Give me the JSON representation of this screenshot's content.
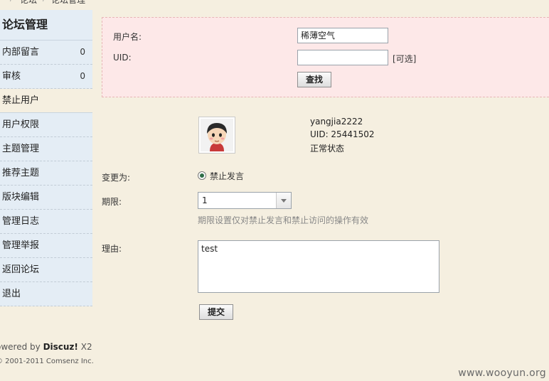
{
  "breadcrumb": {
    "items": [
      "论坛",
      "论坛管理"
    ],
    "separator": "/"
  },
  "sidebar": {
    "title": "论坛管理",
    "items": [
      {
        "label": "内部留言",
        "count": "0"
      },
      {
        "label": "审核",
        "count": "0"
      },
      {
        "label": "禁止用户",
        "count": ""
      },
      {
        "label": "用户权限",
        "count": ""
      },
      {
        "label": "主题管理",
        "count": ""
      },
      {
        "label": "推荐主题",
        "count": ""
      },
      {
        "label": "版块编辑",
        "count": ""
      },
      {
        "label": "管理日志",
        "count": ""
      },
      {
        "label": "管理举报",
        "count": ""
      },
      {
        "label": "返回论坛",
        "count": ""
      },
      {
        "label": "退出",
        "count": ""
      }
    ],
    "active_index": 2
  },
  "search": {
    "username_label": "用户名:",
    "username_value": "稀薄空气",
    "uid_label": "UID:",
    "uid_value": "",
    "uid_optional": "[可选]",
    "search_button": "查找"
  },
  "user": {
    "avatar_icon": "avatar-cartoon-icon",
    "name": "yangjia2222",
    "uid": "UID: 25441502",
    "status": "正常状态"
  },
  "form": {
    "change_to_label": "变更为:",
    "change_to_option": "禁止发言",
    "period_label": "期限:",
    "period_value": "1",
    "period_hint": "期限设置仅对禁止发言和禁止访问的操作有效",
    "reason_label": "理由:",
    "reason_value": "test",
    "submit_button": "提交"
  },
  "footer": {
    "powered_prefix": "owered by ",
    "powered_brand": "Discuz!",
    "powered_version": " X2",
    "copyright": "© 2001-2011 Comsenz Inc."
  },
  "watermark": "www.wooyun.org",
  "colors": {
    "page_bg": "#f5efe0",
    "sidebar_bg": "#e4edf5",
    "search_panel_bg": "#fde8e8",
    "radio_selected": "#2f6e48"
  }
}
